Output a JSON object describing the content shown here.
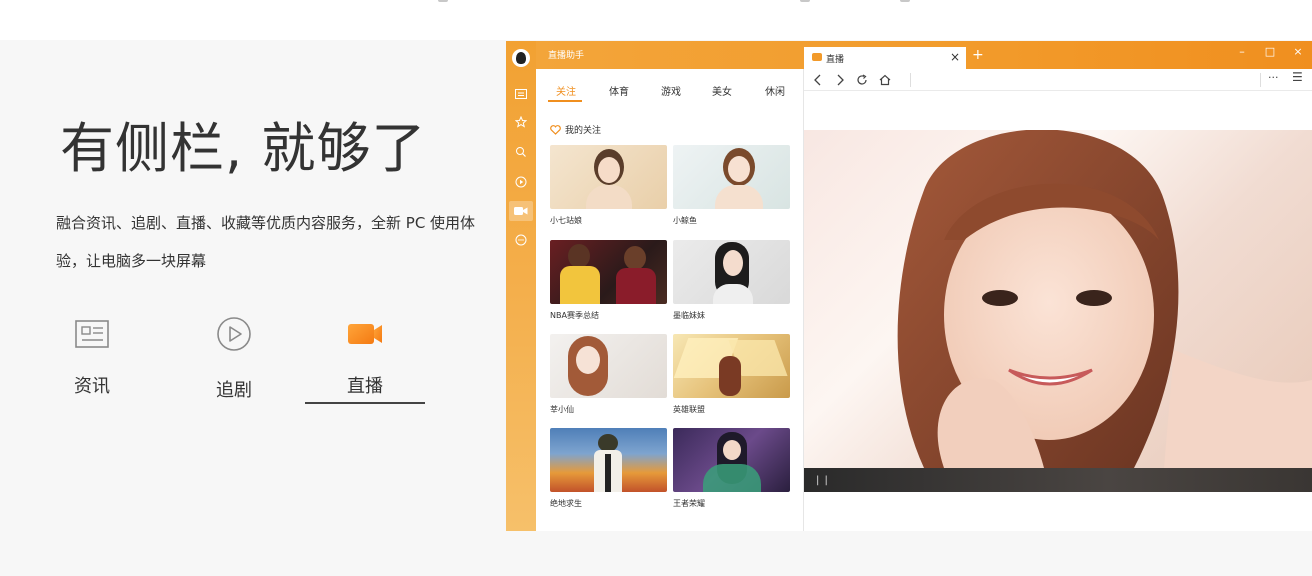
{
  "hero": {
    "title": "有侧栏, 就够了",
    "description": "融合资讯、追剧、直播、收藏等优质内容服务，全新 PC 使用体验，让电脑多一块屏幕"
  },
  "features": [
    {
      "label": "资讯",
      "icon": "news-icon"
    },
    {
      "label": "追剧",
      "icon": "play-icon"
    },
    {
      "label": "直播",
      "icon": "video-camera-icon",
      "active": true
    }
  ],
  "app": {
    "title": "直播助手",
    "browser_tab": "直播",
    "tab_close": "×",
    "new_tab": "+",
    "window_controls": [
      "–",
      "□",
      "×"
    ],
    "categories": [
      "关注",
      "体育",
      "游戏",
      "美女",
      "休闲"
    ],
    "active_category": "关注",
    "section_title": "我的关注",
    "streams": [
      {
        "caption": "小七站娘"
      },
      {
        "caption": "小鲸鱼"
      },
      {
        "caption": "NBA赛季总结"
      },
      {
        "caption": "墨临妹妹"
      },
      {
        "caption": "莘小仙"
      },
      {
        "caption": "英雄联盟"
      },
      {
        "caption": "绝地求生"
      },
      {
        "caption": "王者荣耀"
      }
    ],
    "player_pause": "| |",
    "toolbar_more": "···",
    "toolbar_menu": "☰"
  },
  "colors": {
    "accent": "#f08f1f",
    "text": "#333333",
    "section_bg": "#f7f7f7"
  }
}
